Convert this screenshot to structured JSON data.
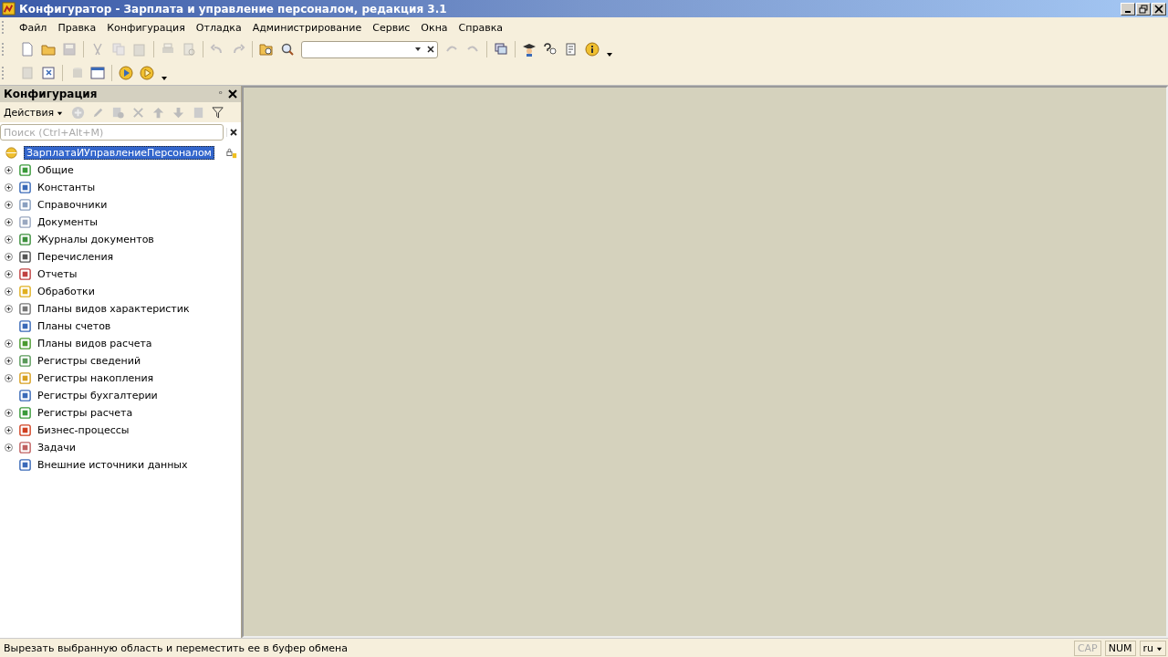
{
  "window": {
    "title": "Конфигуратор - Зарплата и управление персоналом, редакция 3.1"
  },
  "menu": [
    "Файл",
    "Правка",
    "Конфигурация",
    "Отладка",
    "Администрирование",
    "Сервис",
    "Окна",
    "Справка"
  ],
  "panel": {
    "title": "Конфигурация",
    "pin": "ᵒ",
    "actions": "Действия",
    "search": {
      "placeholder": "Поиск (Ctrl+Alt+M)"
    }
  },
  "tree": {
    "root": {
      "label": "ЗарплатаИУправлениеПерсоналом",
      "selected": true
    },
    "items": [
      {
        "label": "Общие",
        "expandable": true
      },
      {
        "label": "Константы",
        "expandable": true
      },
      {
        "label": "Справочники",
        "expandable": true
      },
      {
        "label": "Документы",
        "expandable": true
      },
      {
        "label": "Журналы документов",
        "expandable": true
      },
      {
        "label": "Перечисления",
        "expandable": true
      },
      {
        "label": "Отчеты",
        "expandable": true
      },
      {
        "label": "Обработки",
        "expandable": true
      },
      {
        "label": "Планы видов характеристик",
        "expandable": true
      },
      {
        "label": "Планы счетов",
        "expandable": false
      },
      {
        "label": "Планы видов расчета",
        "expandable": true
      },
      {
        "label": "Регистры сведений",
        "expandable": true
      },
      {
        "label": "Регистры накопления",
        "expandable": true
      },
      {
        "label": "Регистры бухгалтерии",
        "expandable": false
      },
      {
        "label": "Регистры расчета",
        "expandable": true
      },
      {
        "label": "Бизнес-процессы",
        "expandable": true
      },
      {
        "label": "Задачи",
        "expandable": true
      },
      {
        "label": "Внешние источники данных",
        "expandable": false
      }
    ]
  },
  "status_bar": {
    "message": "Вырезать выбранную область и переместить ее в буфер обмена",
    "indicators": [
      {
        "label": "CAP",
        "on": false
      },
      {
        "label": "NUM",
        "on": true
      }
    ],
    "language": "ru"
  }
}
